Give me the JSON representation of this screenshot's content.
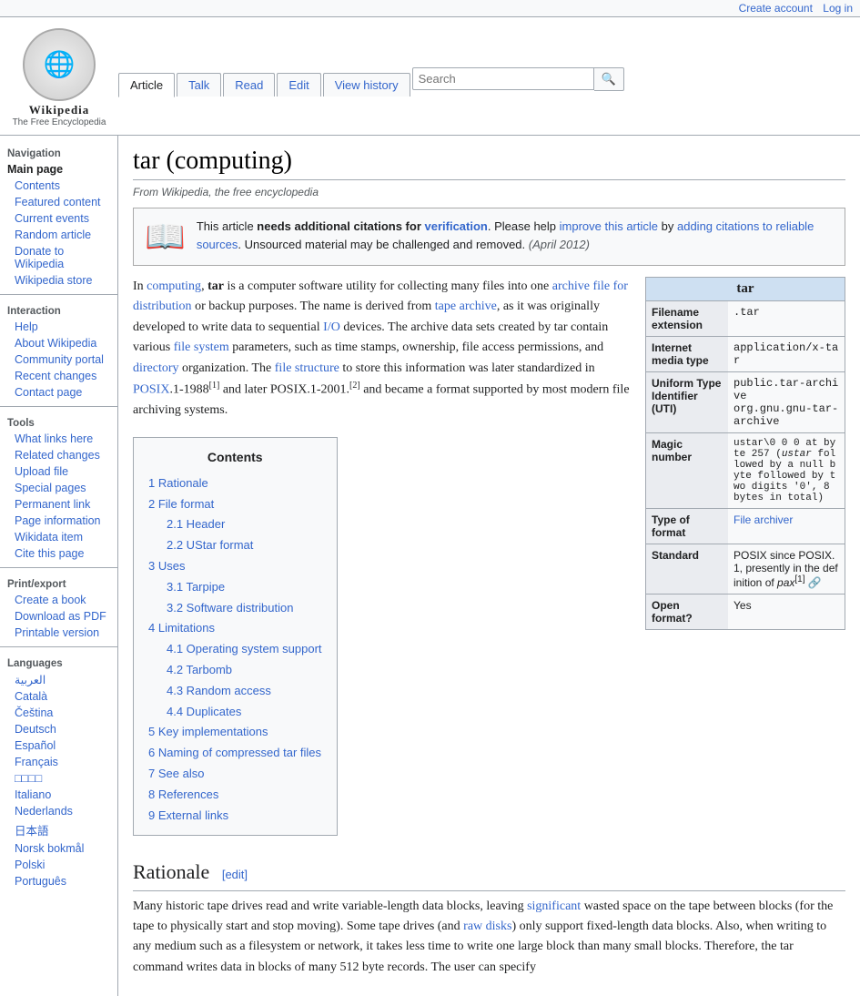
{
  "topbar": {
    "create_account": "Create account",
    "log_in": "Log in"
  },
  "logo": {
    "symbol": "🌐",
    "title": "Wikipedia",
    "subtitle": "The Free Encyclopedia"
  },
  "tabs": {
    "article": "Article",
    "talk": "Talk",
    "read": "Read",
    "edit": "Edit",
    "view_history": "View history"
  },
  "search": {
    "placeholder": "Search",
    "button": "🔍"
  },
  "sidebar": {
    "navigation_title": "Navigation",
    "main_page": "Main page",
    "contents": "Contents",
    "featured_content": "Featured content",
    "current_events": "Current events",
    "random_article": "Random article",
    "donate": "Donate to Wikipedia",
    "wikipedia_store": "Wikipedia store",
    "interaction_title": "Interaction",
    "help": "Help",
    "about": "About Wikipedia",
    "community_portal": "Community portal",
    "recent_changes": "Recent changes",
    "contact": "Contact page",
    "tools_title": "Tools",
    "what_links": "What links here",
    "related_changes": "Related changes",
    "upload_file": "Upload file",
    "special_pages": "Special pages",
    "permanent_link": "Permanent link",
    "page_info": "Page information",
    "wikidata": "Wikidata item",
    "cite": "Cite this page",
    "print_title": "Print/export",
    "create_book": "Create a book",
    "download_pdf": "Download as PDF",
    "printable": "Printable version",
    "languages_title": "Languages",
    "langs": [
      "العربية",
      "Català",
      "Čeština",
      "Deutsch",
      "Español",
      "Français",
      "□□□□",
      "Italiano",
      "Nederlands",
      "日本語",
      "Norsk bokmål",
      "Polski",
      "Português"
    ]
  },
  "page": {
    "title": "tar (computing)",
    "subtitle": "From Wikipedia, the free encyclopedia"
  },
  "warning": {
    "icon": "📖",
    "text_plain": "This article ",
    "text_bold": "needs additional citations for",
    "text_link": "verification",
    "text_after": ". Please help ",
    "text_link2": "improve this article",
    "text_after2": " by ",
    "text_link3": "adding citations to reliable sources",
    "text_after3": ". Unsourced material may be challenged and removed.",
    "text_date": " (April 2012)"
  },
  "infobox": {
    "title": "tar",
    "rows": [
      {
        "label": "Filename extension",
        "value": ".tar",
        "link": false
      },
      {
        "label": "Internet media type",
        "value": "application/x-tar",
        "link": false
      },
      {
        "label": "Uniform Type Identifier (UTI)",
        "value": "public.tar-archive\norg.gnu.gnu-tar-archive",
        "link": false
      },
      {
        "label": "Magic number",
        "value": "ustar\\0 0 0 at byte 257 (ustar followed by a null byte followed by two digits '0', 8 bytes in total)",
        "link": false
      },
      {
        "label": "Type of format",
        "value": "File archiver",
        "link": true
      },
      {
        "label": "Standard",
        "value": "POSIX since POSIX.1, presently in the definition of pax[1]",
        "link": false
      },
      {
        "label": "Open format?",
        "value": "Yes",
        "link": false
      }
    ]
  },
  "contents": {
    "title": "Contents",
    "items": [
      {
        "num": "1",
        "label": "Rationale",
        "sub": []
      },
      {
        "num": "2",
        "label": "File format",
        "sub": [
          {
            "num": "2.1",
            "label": "Header"
          },
          {
            "num": "2.2",
            "label": "UStar format"
          }
        ]
      },
      {
        "num": "3",
        "label": "Uses",
        "sub": [
          {
            "num": "3.1",
            "label": "Tarpipe"
          },
          {
            "num": "3.2",
            "label": "Software distribution"
          }
        ]
      },
      {
        "num": "4",
        "label": "Limitations",
        "sub": [
          {
            "num": "4.1",
            "label": "Operating system support"
          },
          {
            "num": "4.2",
            "label": "Tarbomb"
          },
          {
            "num": "4.3",
            "label": "Random access"
          },
          {
            "num": "4.4",
            "label": "Duplicates"
          }
        ]
      },
      {
        "num": "5",
        "label": "Key implementations",
        "sub": []
      },
      {
        "num": "6",
        "label": "Naming of compressed tar files",
        "sub": []
      },
      {
        "num": "7",
        "label": "See also",
        "sub": []
      },
      {
        "num": "8",
        "label": "References",
        "sub": []
      },
      {
        "num": "9",
        "label": "External links",
        "sub": []
      }
    ]
  },
  "article": {
    "intro": "In computing, tar is a computer software utility for collecting many files into one archive file for distribution or backup purposes. The name is derived from tape archive, as it was originally developed to write data to sequential I/O devices. The archive data sets created by tar contain various file system parameters, such as time stamps, ownership, file access permissions, and directory organization. The file structure to store this information was later standardized in POSIX.1-1988[1] and later POSIX.1-2001.[2] and became a format supported by most modern file archiving systems.",
    "rationale_title": "Rationale",
    "rationale_edit": "[edit]",
    "rationale_text": "Many historic tape drives read and write variable-length data blocks, leaving significant wasted space on the tape between blocks (for the tape to physically start and stop moving). Some tape drives (and raw disks) only support fixed-length data blocks. Also, when writing to any medium such as a filesystem or network, it takes less time to write one large block than many small blocks. Therefore, the tar command writes data in blocks of many 512 byte records. The user can specify"
  }
}
